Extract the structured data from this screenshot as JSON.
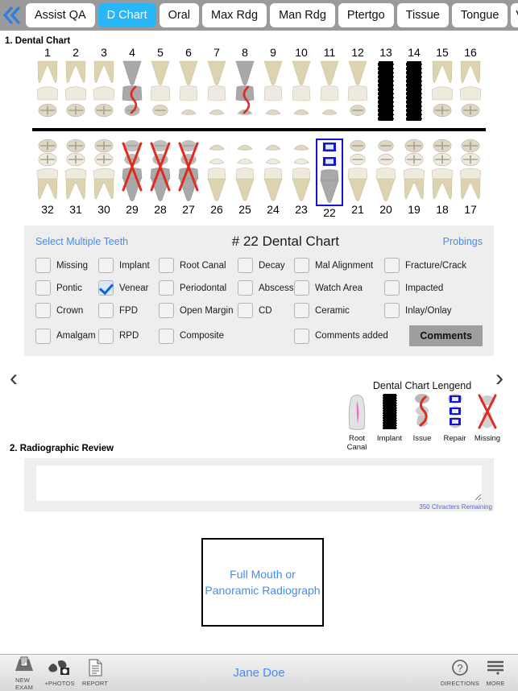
{
  "tabbar": {
    "prev_icon": "double-chevron-left-icon",
    "next_icon": "double-chevron-right-icon",
    "tabs": [
      {
        "label": "Assist QA",
        "active": false
      },
      {
        "label": "D Chart",
        "active": true
      },
      {
        "label": "Oral",
        "active": false
      },
      {
        "label": "Max Rdg",
        "active": false
      },
      {
        "label": "Man Rdg",
        "active": false
      },
      {
        "label": "Ptertgo",
        "active": false
      },
      {
        "label": "Tissue",
        "active": false
      },
      {
        "label": "Tongue",
        "active": false
      },
      {
        "label": "V S",
        "active": false
      }
    ]
  },
  "section1": {
    "number": "1.",
    "title": "Dental Chart"
  },
  "section2": {
    "number": "2.",
    "title": "Radiographic Review"
  },
  "chart": {
    "upper": [
      {
        "num": "1",
        "state": "normal",
        "type": "molar"
      },
      {
        "num": "2",
        "state": "normal",
        "type": "molar"
      },
      {
        "num": "3",
        "state": "normal",
        "type": "molar"
      },
      {
        "num": "4",
        "state": "issue",
        "type": "premolar"
      },
      {
        "num": "5",
        "state": "normal",
        "type": "premolar"
      },
      {
        "num": "6",
        "state": "normal",
        "type": "canine"
      },
      {
        "num": "7",
        "state": "normal",
        "type": "incisor"
      },
      {
        "num": "8",
        "state": "issue",
        "type": "incisor"
      },
      {
        "num": "9",
        "state": "normal",
        "type": "incisor"
      },
      {
        "num": "10",
        "state": "normal",
        "type": "incisor"
      },
      {
        "num": "11",
        "state": "normal",
        "type": "canine"
      },
      {
        "num": "12",
        "state": "normal",
        "type": "premolar"
      },
      {
        "num": "13",
        "state": "implant",
        "type": "implant"
      },
      {
        "num": "14",
        "state": "implant",
        "type": "implant"
      },
      {
        "num": "15",
        "state": "normal",
        "type": "molar"
      },
      {
        "num": "16",
        "state": "normal",
        "type": "molar"
      }
    ],
    "lower": [
      {
        "num": "32",
        "state": "normal",
        "type": "molar"
      },
      {
        "num": "31",
        "state": "normal",
        "type": "molar"
      },
      {
        "num": "30",
        "state": "normal",
        "type": "molar"
      },
      {
        "num": "29",
        "state": "missing",
        "type": "premolar"
      },
      {
        "num": "28",
        "state": "missing",
        "type": "premolar"
      },
      {
        "num": "27",
        "state": "missing",
        "type": "premolar"
      },
      {
        "num": "26",
        "state": "normal",
        "type": "canine"
      },
      {
        "num": "25",
        "state": "normal",
        "type": "incisor"
      },
      {
        "num": "24",
        "state": "normal",
        "type": "incisor"
      },
      {
        "num": "23",
        "state": "normal",
        "type": "incisor"
      },
      {
        "num": "22",
        "state": "repair",
        "type": "canine",
        "selected": true
      },
      {
        "num": "21",
        "state": "normal",
        "type": "premolar"
      },
      {
        "num": "20",
        "state": "normal",
        "type": "premolar"
      },
      {
        "num": "19",
        "state": "normal",
        "type": "molar"
      },
      {
        "num": "18",
        "state": "normal",
        "type": "molar"
      },
      {
        "num": "17",
        "state": "normal",
        "type": "molar"
      }
    ]
  },
  "panel": {
    "select_multiple": "Select Multiple Teeth",
    "title": "# 22 Dental Chart",
    "probings": "Probings",
    "comments_button": "Comments",
    "options": [
      {
        "label": "Missing",
        "checked": false
      },
      {
        "label": "Implant",
        "checked": false
      },
      {
        "label": "Root Canal",
        "checked": false
      },
      {
        "label": "Decay",
        "checked": false
      },
      {
        "label": "Mal Alignment",
        "checked": false
      },
      {
        "label": "Fracture/Crack",
        "checked": false
      },
      {
        "label": "Pontic",
        "checked": false
      },
      {
        "label": "Venear",
        "checked": true
      },
      {
        "label": "Periodontal",
        "checked": false
      },
      {
        "label": "Abscess",
        "checked": false
      },
      {
        "label": "Watch Area",
        "checked": false
      },
      {
        "label": "Impacted",
        "checked": false
      },
      {
        "label": "Crown",
        "checked": false
      },
      {
        "label": "FPD",
        "checked": false
      },
      {
        "label": "Open Margin",
        "checked": false
      },
      {
        "label": "CD",
        "checked": false
      },
      {
        "label": "Ceramic",
        "checked": false
      },
      {
        "label": "Inlay/Onlay",
        "checked": false
      },
      {
        "label": "Amalgam",
        "checked": false
      },
      {
        "label": "RPD",
        "checked": false
      },
      {
        "label": "Composite",
        "checked": false
      },
      {
        "label": "",
        "checked": null
      },
      {
        "label": "Comments added",
        "checked": false
      }
    ],
    "nav_prev_icon": "chevron-left-icon",
    "nav_next_icon": "chevron-right-icon"
  },
  "legend": {
    "title": "Dental Chart Lengend",
    "items": [
      {
        "label": "Root Canal",
        "icon": "root-canal-tooth-icon"
      },
      {
        "label": "Implant",
        "icon": "implant-screw-icon"
      },
      {
        "label": "Issue",
        "icon": "issue-tooth-icon"
      },
      {
        "label": "Repair",
        "icon": "repair-tooth-icon"
      },
      {
        "label": "Missing",
        "icon": "missing-tooth-icon"
      }
    ]
  },
  "radiographic": {
    "textarea_value": "",
    "textarea_placeholder": "",
    "chars_remaining": "350 Chracters Remaining"
  },
  "radiograph_box": {
    "label": "Full Mouth or\nPanoramic Radiograph"
  },
  "footer": {
    "buttons": [
      {
        "label": "New\nExam",
        "icon": "new-exam-icon"
      },
      {
        "label": "+Photos",
        "icon": "photos-icon"
      },
      {
        "label": "Report",
        "icon": "report-icon"
      }
    ],
    "patient_name": "Jane Doe",
    "right_buttons": [
      {
        "label": "Directions",
        "icon": "question-circle-icon"
      },
      {
        "label": "More",
        "icon": "hamburger-icon"
      }
    ]
  },
  "colors": {
    "accent_blue": "#3e8ef7",
    "active_tab": "#29b6f6",
    "missing_red": "#e02b20",
    "repair_blue": "#1414d8",
    "panel_gray": "#eeeeee"
  }
}
